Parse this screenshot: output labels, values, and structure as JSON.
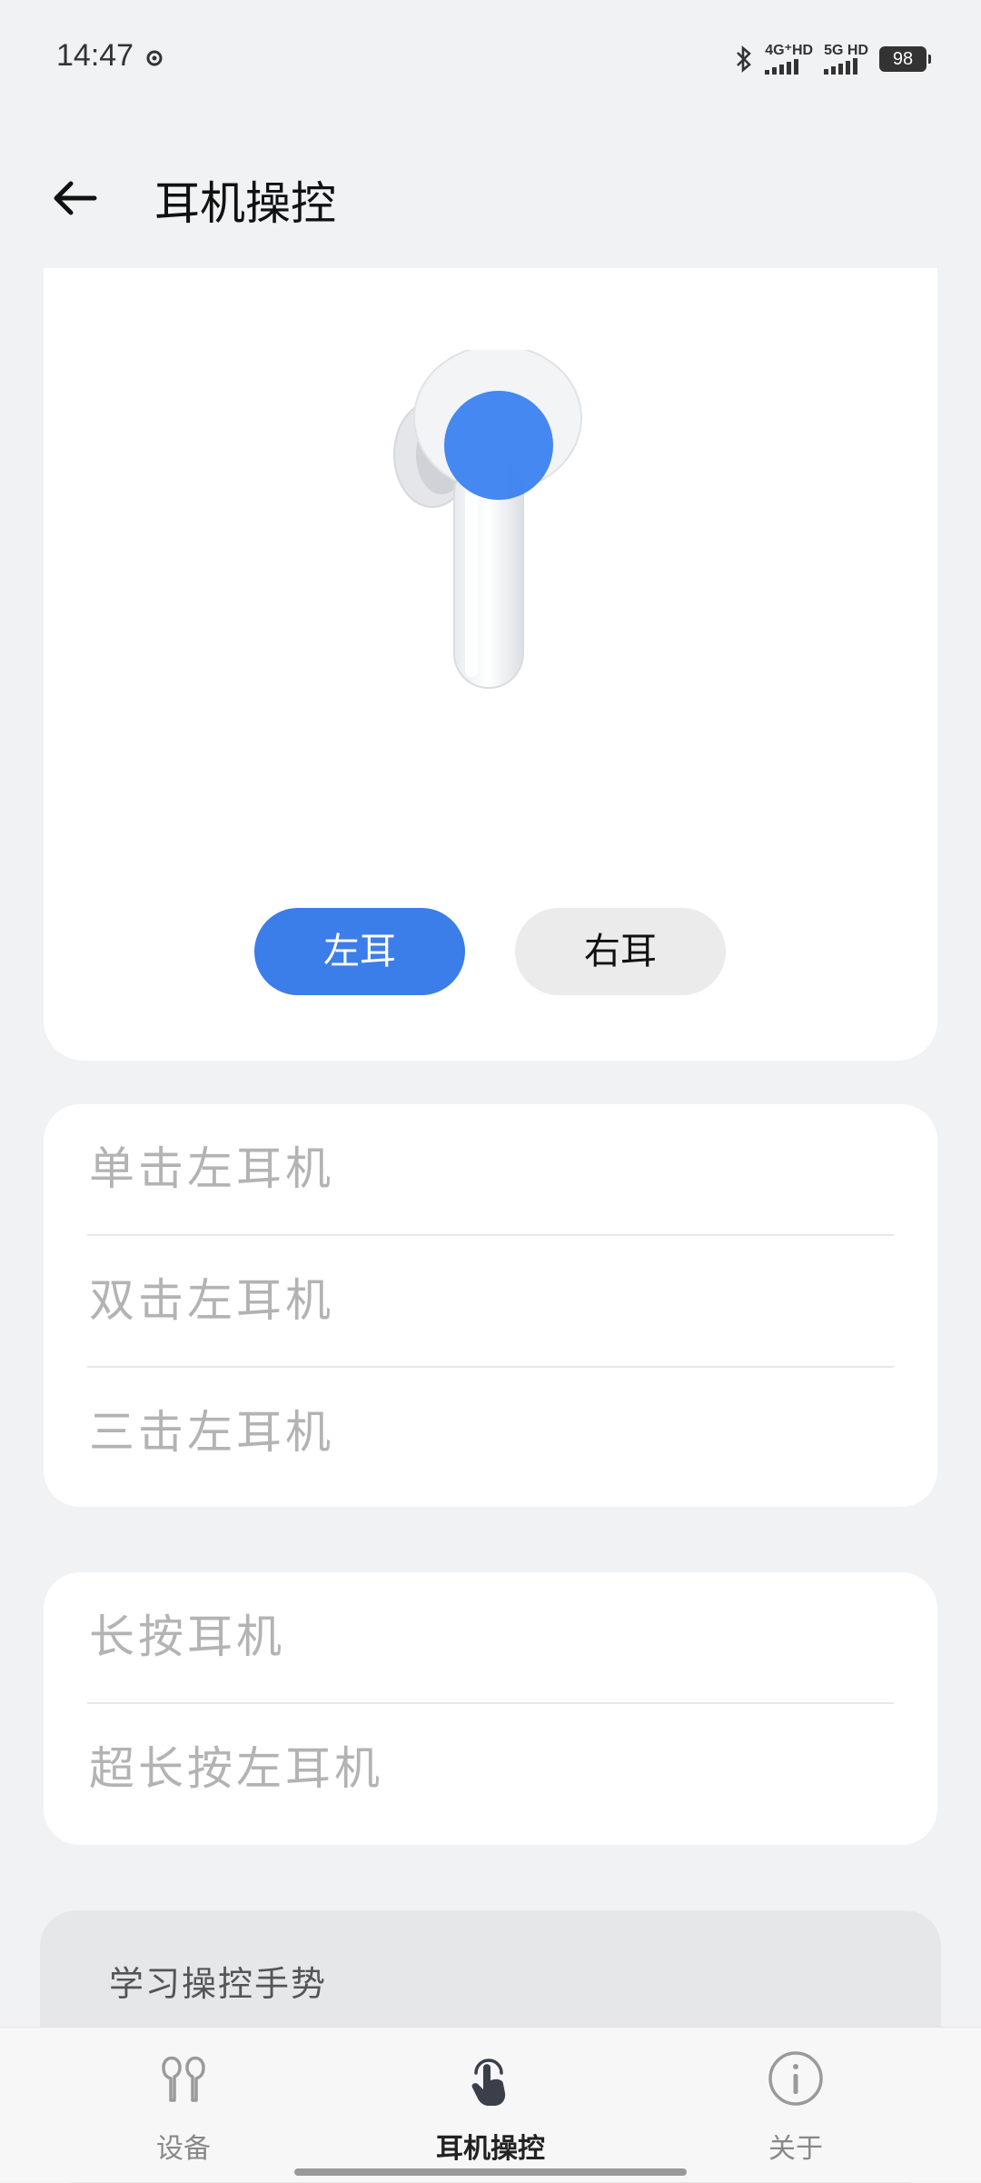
{
  "status_bar": {
    "time": "14:47",
    "network_1": "4G⁺HD",
    "network_2": "5G HD",
    "battery": "98",
    "icons": [
      "location-ring-icon",
      "bluetooth-icon",
      "signal-icon",
      "battery-icon"
    ]
  },
  "header": {
    "title": "耳机操控",
    "back_icon": "arrow-left-icon"
  },
  "hero": {
    "image": "earbud-illustration",
    "highlight_color": "#3b82f0",
    "left_ear_label": "左耳",
    "right_ear_label": "右耳",
    "selected": "左耳"
  },
  "gesture_group_1": {
    "items": [
      {
        "label": "单击左耳机"
      },
      {
        "label": "双击左耳机"
      },
      {
        "label": "三击左耳机"
      }
    ]
  },
  "gesture_group_2": {
    "items": [
      {
        "label": "长按耳机"
      },
      {
        "label": "超长按左耳机"
      }
    ]
  },
  "tutorial": {
    "label": "学习操控手势"
  },
  "bottom_nav": {
    "items": [
      {
        "label": "设备",
        "icon": "earbuds-icon",
        "active": false
      },
      {
        "label": "耳机操控",
        "icon": "touch-hand-icon",
        "active": true
      },
      {
        "label": "关于",
        "icon": "info-icon",
        "active": false
      }
    ]
  },
  "colors": {
    "accent": "#3b7de9",
    "background": "#f1f2f4",
    "item_text": "#b3b3b3"
  }
}
